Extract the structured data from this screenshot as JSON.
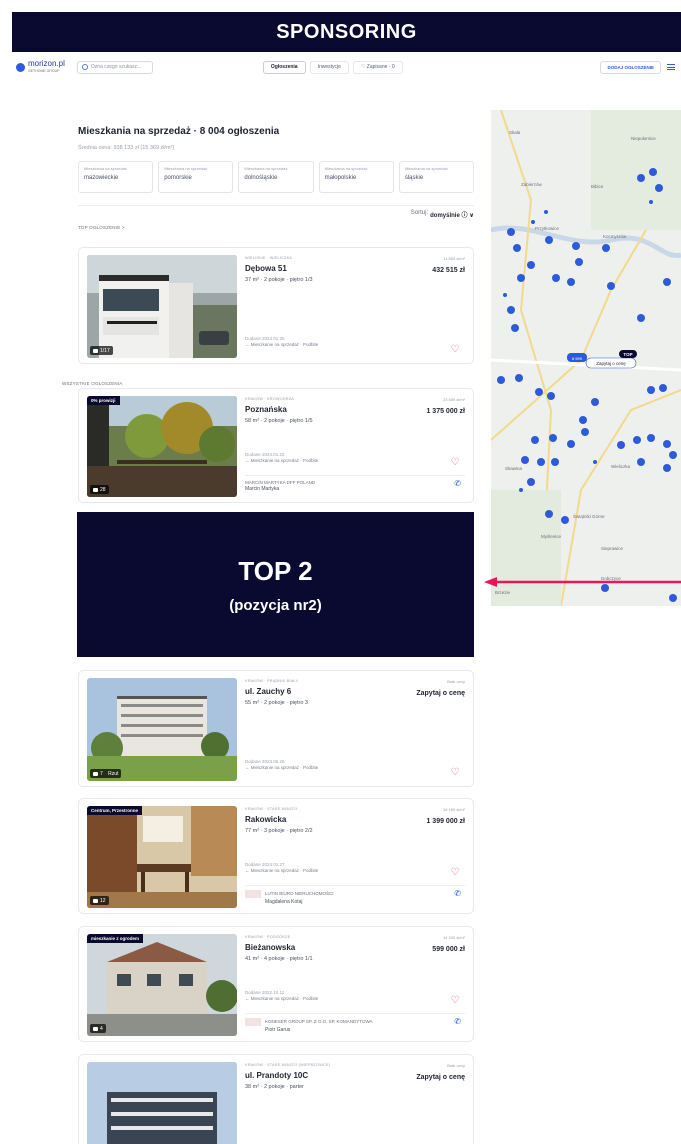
{
  "banner": {
    "title": "SPONSORING"
  },
  "nav": {
    "logo": "morizon.pl",
    "logo_sub": "GETHOME GROUP",
    "search_placeholder": "Ozna czego szukasz...",
    "tabs": [
      {
        "label": "Ogłoszenia",
        "active": true
      },
      {
        "label": "Inwestycje",
        "active": false
      },
      {
        "label": "♡ Zapisane · 0",
        "active": false
      }
    ],
    "add_button": "DODAJ OGŁOSZENIE"
  },
  "listing_header": {
    "title": "Mieszkania na sprzedaż · 8 004 ogłoszenia",
    "avg_price": "Średnia cena: 938 133 zł (15 369 zł/m²)",
    "regions": [
      {
        "top": "Mieszkania na sprzedaż",
        "name": "mazowieckie"
      },
      {
        "top": "Mieszkania na sprzedaż",
        "name": "pomorskie"
      },
      {
        "top": "Mieszkania na sprzedaż",
        "name": "dolnośląskie"
      },
      {
        "top": "Mieszkania na sprzedaż",
        "name": "małopolskie"
      },
      {
        "top": "Mieszkania na sprzedaż",
        "name": "śląskie"
      }
    ],
    "sort_label": "Sortuj:",
    "sort_value": "domyślnie ⓘ ∨",
    "top_label": "TOP OGŁOSZENIE >",
    "all_label": "WSZYSTKIE OGŁOSZENIA"
  },
  "cards": [
    {
      "tag": "",
      "photos": "1/17",
      "location": "WIELISKIE · WIELICZKA",
      "price_m2": "11 669 zł/m²",
      "street": "Dębowa 51",
      "price": "432 515 zł",
      "params": "37 m² · 2 pokoje · piętro 1/3",
      "added": "Dodane 2024.01.25",
      "category": "← Mieszkanie na sprzedaż · Podbite",
      "agency": "",
      "agent": ""
    },
    {
      "tag": "0% prowizji",
      "photos": "28",
      "location": "KRAKÓW · KROWODRZA",
      "price_m2": "23 559 zł/m²",
      "street": "Poznańska",
      "price": "1 375 000 zł",
      "params": "58 m² · 2 pokoje · piętro 1/5",
      "added": "Dodane 2024.01.22",
      "category": "← Mieszkanie na sprzedaż · Podbite",
      "agency": "MARCIN MARTYKA DFF POLAND",
      "agent": "Marcin Martyka"
    },
    {
      "tag": "",
      "photos": "7",
      "location": "KRAKÓW · PRĄDNIK BIAŁY",
      "price_m2": "Brak ceny",
      "street": "ul. Zauchy 6",
      "price": "Zapytaj o cenę",
      "params": "55 m² · 2 pokoje · piętro 3",
      "added": "Dodane 2023.06.26",
      "category": "← Mieszkanie na sprzedaż · Podbite",
      "agency": "",
      "agent": "",
      "extra": "Rzut"
    },
    {
      "tag": "Centrum, Przestronne",
      "photos": "12",
      "location": "KRAKÓW · STARE MIASTO",
      "price_m2": "18 169 zł/m²",
      "street": "Rakowicka",
      "price": "1 399 000 zł",
      "params": "77 m² · 3 pokoje · piętro 2/2",
      "added": "Dodane 2024.01.27",
      "category": "← Mieszkanie na sprzedaż · Podbite",
      "agency": "LUTIN BIURO NIERUCHOMOŚCI",
      "agent": "Magdalena Kotaj"
    },
    {
      "tag": "mieszkanie z ogrodem",
      "photos": "4",
      "location": "KRAKÓW · PODGÓRZE",
      "price_m2": "14 330 zł/m²",
      "street": "Bieżanowska",
      "price": "599 000 zł",
      "params": "41 m² · 4 pokoje · piętro 1/1",
      "added": "Dodane 2022.10.11",
      "category": "← Mieszkanie na sprzedaż · Podbite",
      "agency": "KONESER GROUP SP. Z O.O. SP. KOMANDYTOWA",
      "agent": "Piotr Garus"
    },
    {
      "tag": "",
      "photos": "",
      "location": "KRAKÓW · STARE MIASTO (WIEPRZOWCE)",
      "price_m2": "Brak ceny",
      "street": "ul. Prandoty 10C",
      "price": "Zapytaj o cenę",
      "params": "38 m² · 2 pokoje · parter",
      "added": "",
      "category": "",
      "agency": "",
      "agent": ""
    }
  ],
  "top2": {
    "title": "TOP 2",
    "subtitle": "(pozycja nr2)"
  },
  "map": {
    "labels": [
      "Skała",
      "Zabierzów",
      "Bibice",
      "Przytkowice",
      "Skawina",
      "Wieliczka",
      "Niepołomice",
      "Świątniki Górne",
      "Myślenice",
      "Sieprawice",
      "Dobczyce",
      "Brzezie",
      "Kocmyrzów"
    ],
    "price_bubble": "Zapytaj o cenę",
    "top_badge": "TOP",
    "count_badge": "6 599"
  },
  "colors": {
    "navy": "#0a0930",
    "accent_blue": "#2d5ad9",
    "heart": "#e0457b",
    "arrow": "#e8175d"
  }
}
